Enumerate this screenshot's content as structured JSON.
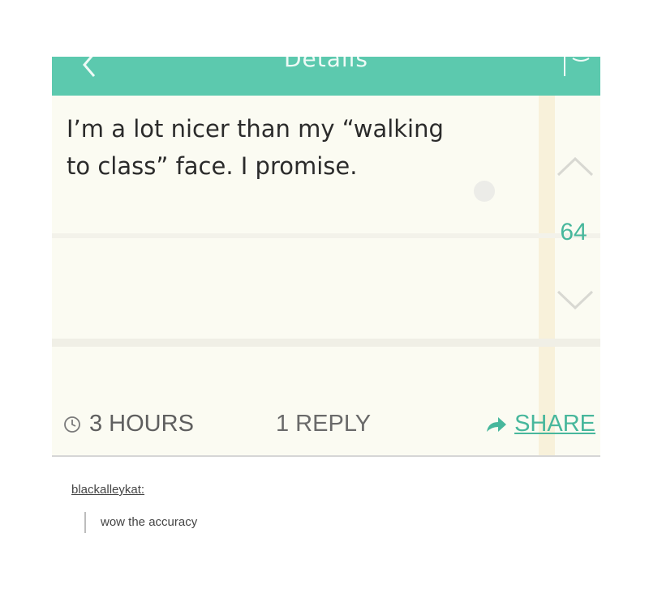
{
  "header": {
    "title": "Details"
  },
  "post": {
    "text_line1": "I’m a lot nicer than my “walking",
    "text_line2": "to class” face. I promise.",
    "vote_count": "64",
    "time": "3 HOURS",
    "replies": "1 REPLY",
    "share_label": "SHARE"
  },
  "comment": {
    "username": "blackalleykat:",
    "body": "wow the accuracy"
  },
  "colors": {
    "header_bg": "#5cc9ae",
    "accent": "#47b79c",
    "post_bg": "#fbfbf2"
  },
  "icons": {
    "back": "chevron-left-icon",
    "header_action": "compose-icon",
    "upvote": "chevron-up-icon",
    "downvote": "chevron-down-icon",
    "time": "clock-icon",
    "share": "share-arrow-icon"
  }
}
